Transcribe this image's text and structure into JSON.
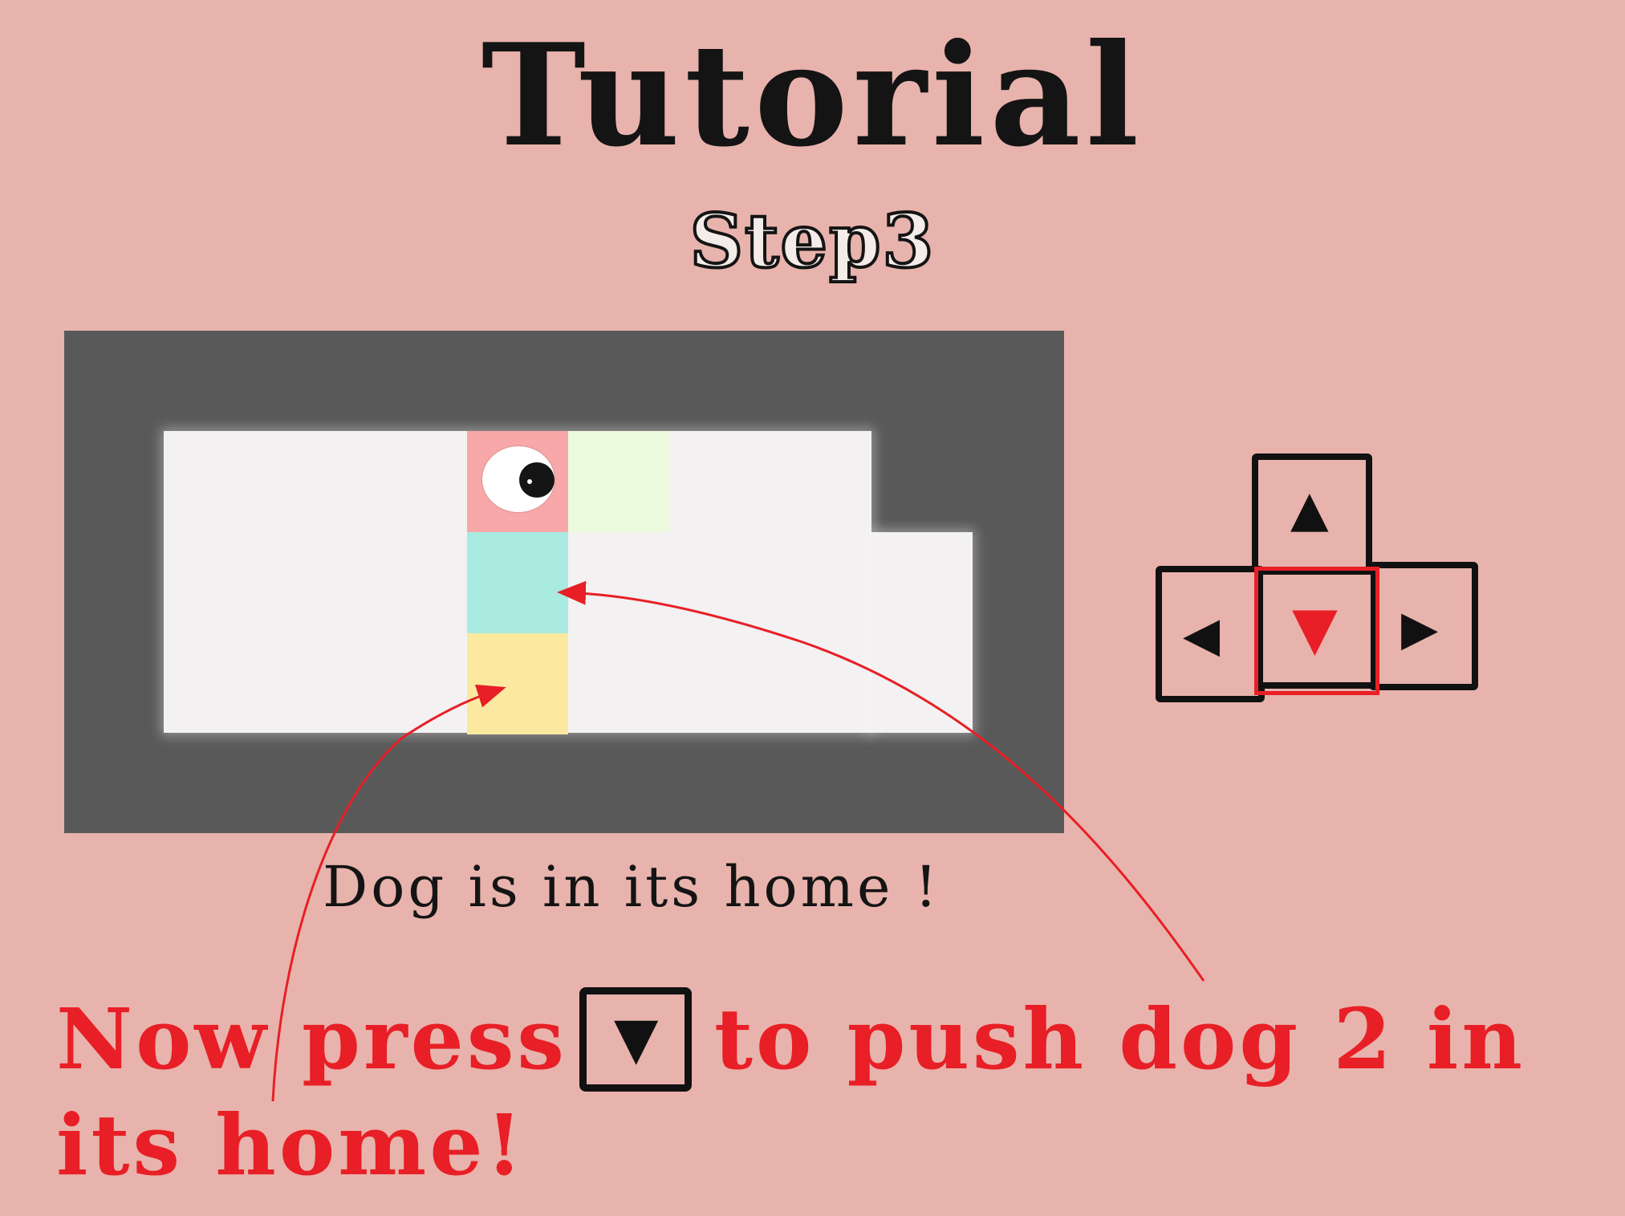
{
  "title": "Tutorial",
  "subtitle": "Step3",
  "status_message": "Dog is in its home !",
  "instruction": {
    "line1_part1": "Now press",
    "line1_part2": "to push dog 2 in",
    "line2": "its home!",
    "inline_key_icon": "down-arrow-key"
  },
  "keys": {
    "up": "▲",
    "down": "▼",
    "left": "◀",
    "right": "▶",
    "highlighted": "down"
  },
  "colors": {
    "background": "#e8b3ac",
    "wall": "#595959",
    "floor": "#f3f1f2",
    "dog_tile": "#f8a8a8",
    "green_tile": "#ecfbdd",
    "cyan_tile": "#a9ebe0",
    "yellow_tile": "#fbe9a0",
    "accent_red": "#e81f26"
  }
}
